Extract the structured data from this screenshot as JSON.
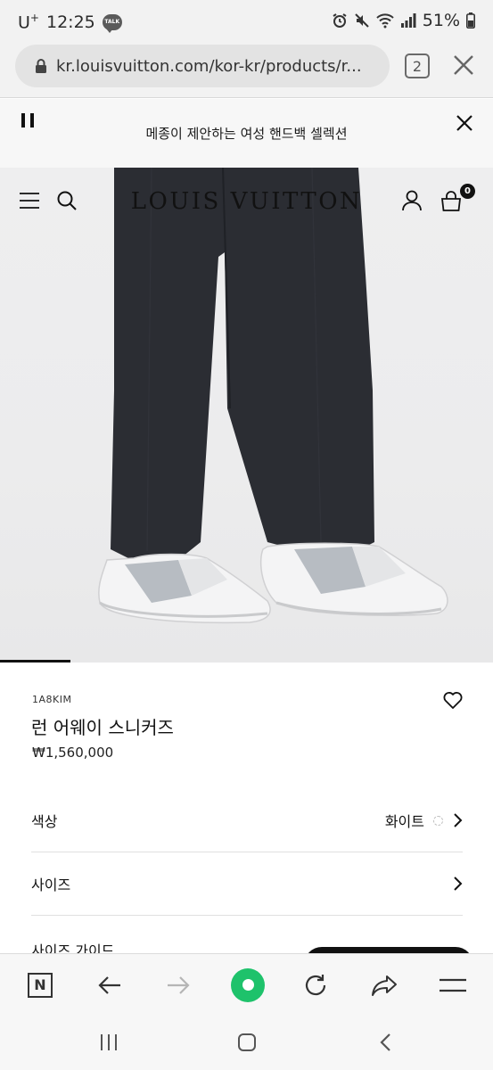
{
  "status_bar": {
    "carrier": "U",
    "carrier_sup": "+",
    "time": "12:25",
    "talk_badge": "TALK",
    "battery": "51%"
  },
  "browser": {
    "url": "kr.louisvuitton.com/kor-kr/products/r...",
    "tab_count": "2"
  },
  "promo": {
    "text": "메종이 제안하는 여성 핸드백 셀렉션"
  },
  "header": {
    "brand": "LOUIS VUITTON",
    "bag_count": "0"
  },
  "product": {
    "sku": "1A8KIM",
    "name": "런 어웨이 스니커즈",
    "price": "₩1,560,000",
    "options": [
      {
        "label": "색상",
        "value": "화이트"
      },
      {
        "label": "사이즈",
        "value": ""
      }
    ],
    "size_guide": "사이즈 가이드"
  },
  "toolbar": {
    "naver_letter": "N"
  },
  "colors": {
    "accent_green": "#1ec26b",
    "brand_black": "#111111"
  }
}
